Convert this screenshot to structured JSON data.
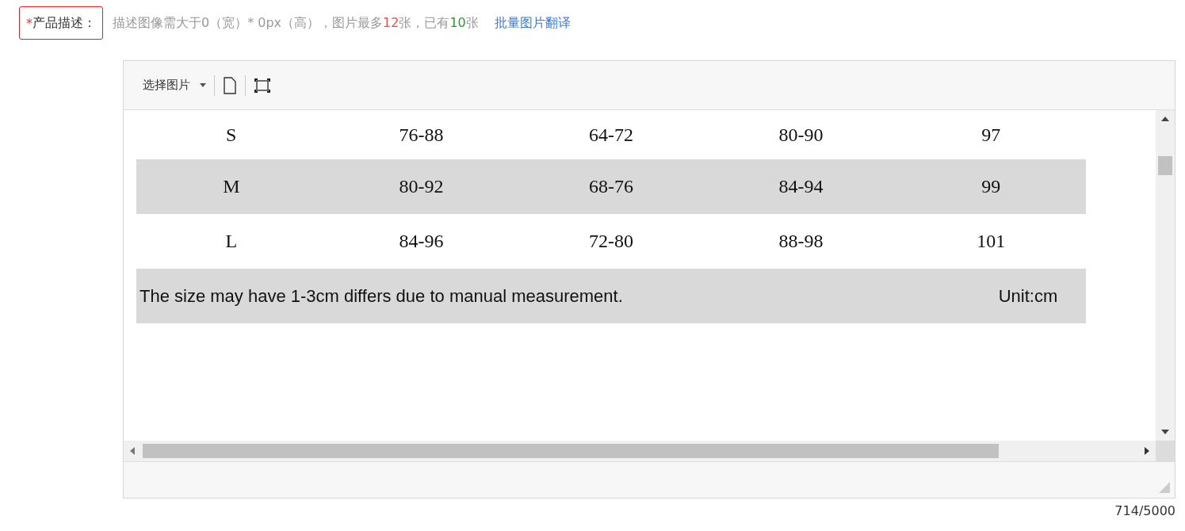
{
  "field": {
    "required_mark": "*",
    "label": "产品描述：",
    "hint": [
      {
        "kind": "plain",
        "text": "描述图像需大于0（宽）* 0px（高），图片最多"
      },
      {
        "kind": "limit",
        "text": "12"
      },
      {
        "kind": "plain",
        "text": "张，已有"
      },
      {
        "kind": "count",
        "text": "10"
      },
      {
        "kind": "plain",
        "text": "张"
      }
    ],
    "link": "批量图片翻译"
  },
  "editor": {
    "toolbar": {
      "dropdown": "选择图片"
    },
    "rows": [
      {
        "kind": "size",
        "shaded": false,
        "cells": [
          "S",
          "76-88",
          "64-72",
          "80-90",
          "97"
        ]
      },
      {
        "kind": "size",
        "shaded": true,
        "cells": [
          "M",
          "80-92",
          "68-76",
          "84-94",
          "99"
        ]
      },
      {
        "kind": "size",
        "shaded": false,
        "cells": [
          "L",
          "84-96",
          "72-80",
          "88-98",
          "101"
        ]
      },
      {
        "kind": "note",
        "shaded": true,
        "cells": [
          "The size may have 1-3cm differs due to manual measurement.",
          "",
          "",
          "",
          "Unit:cm"
        ]
      }
    ]
  },
  "counter": "714/5000"
}
